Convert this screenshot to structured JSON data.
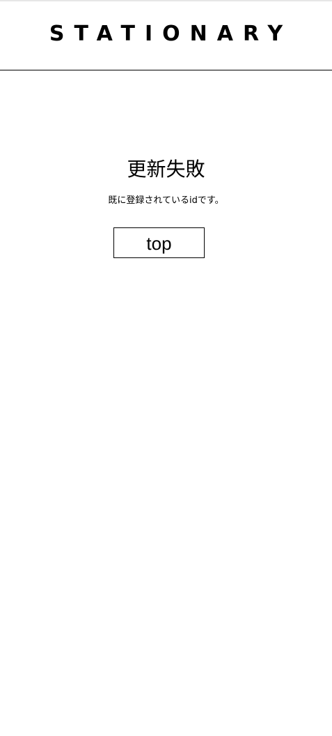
{
  "header": {
    "logo_text": "STATIONARY"
  },
  "main": {
    "title": "更新失敗",
    "message": "既に登録されているidです。",
    "top_button_label": "top"
  }
}
